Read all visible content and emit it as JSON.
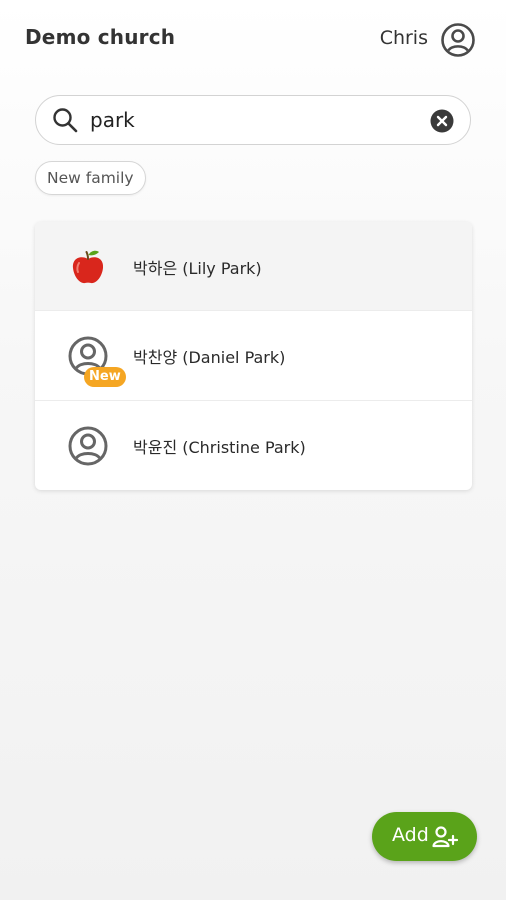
{
  "header": {
    "title": "Demo church",
    "user_name": "Chris",
    "avatar_icon": "account-circle-icon"
  },
  "search": {
    "value": "park",
    "placeholder": "",
    "search_icon": "search-icon",
    "clear_icon": "clear-circle-icon"
  },
  "filters": {
    "chip_label": "New family"
  },
  "results": [
    {
      "label": "박하은 (Lily Park)",
      "icon": "apple-icon",
      "selected": true
    },
    {
      "label": "박찬양 (Daniel Park)",
      "icon": "account-circle-icon",
      "badge": "New"
    },
    {
      "label": "박윤진 (Christine Park)",
      "icon": "account-circle-icon"
    }
  ],
  "fab": {
    "label": "Add",
    "icon": "add-person-icon"
  },
  "colors": {
    "accent_green": "#5aa31a",
    "badge_orange": "#f5a623",
    "icon_gray": "#666666"
  }
}
